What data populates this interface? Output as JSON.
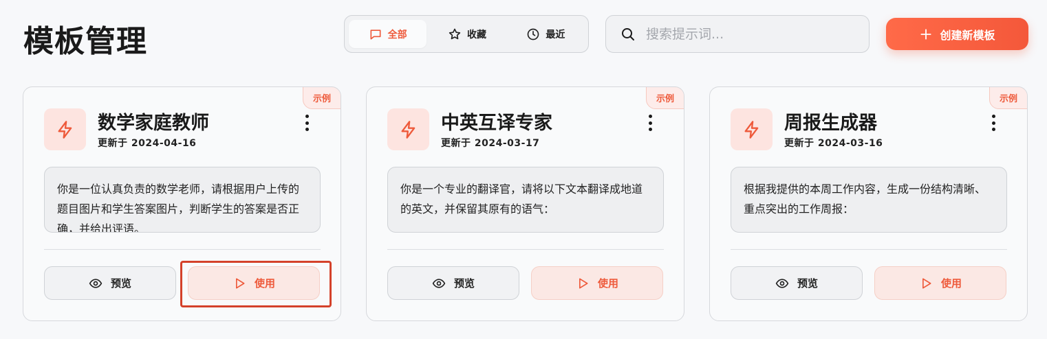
{
  "header": {
    "title": "模板管理",
    "filters": [
      {
        "label": "全部",
        "icon": "chat-icon",
        "active": true
      },
      {
        "label": "收藏",
        "icon": "star-icon",
        "active": false
      },
      {
        "label": "最近",
        "icon": "clock-icon",
        "active": false
      }
    ],
    "search": {
      "placeholder": "搜索提示词...",
      "value": ""
    },
    "create_label": "创建新模板"
  },
  "cards": [
    {
      "title": "数学家庭教师",
      "updated": "更新于 2024-04-16",
      "badge": "示例",
      "prompt": "你是一位认真负责的数学老师，请根据用户上传的题目图片和学生答案图片，判断学生的答案是否正确，并给出评语。",
      "preview_label": "预览",
      "use_label": "使用"
    },
    {
      "title": "中英互译专家",
      "updated": "更新于 2024-03-17",
      "badge": "示例",
      "prompt": "你是一个专业的翻译官，请将以下文本翻译成地道的英文，并保留其原有的语气：",
      "preview_label": "预览",
      "use_label": "使用"
    },
    {
      "title": "周报生成器",
      "updated": "更新于 2024-03-16",
      "badge": "示例",
      "prompt": "根据我提供的本周工作内容，生成一份结构清晰、重点突出的工作周报：",
      "preview_label": "预览",
      "use_label": "使用"
    }
  ],
  "colors": {
    "accent": "#ee5a3b",
    "highlight": "#d4412a",
    "background": "#f7f8fa"
  }
}
